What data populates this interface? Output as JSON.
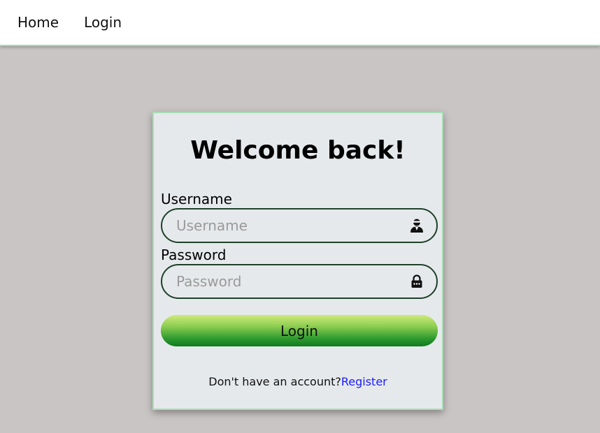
{
  "nav": {
    "home_label": "Home",
    "login_label": "Login"
  },
  "form": {
    "title": "Welcome back!",
    "username_label": "Username",
    "username_placeholder": "Username",
    "password_label": "Password",
    "password_placeholder": "Password",
    "submit_label": "Login",
    "register_prompt": "Don't have an account?",
    "register_link": "Register",
    "icons": {
      "username_icon": "user-icon",
      "password_icon": "lock-icon"
    }
  },
  "colors": {
    "page_background": "#cac5c5",
    "card_background": "#e6e9ec",
    "card_border": "#a8ddb5",
    "field_border": "#1e4029",
    "button_gradient_top": "#cfe97a",
    "button_gradient_bottom": "#0f7a1f",
    "link": "#1a1aff"
  }
}
